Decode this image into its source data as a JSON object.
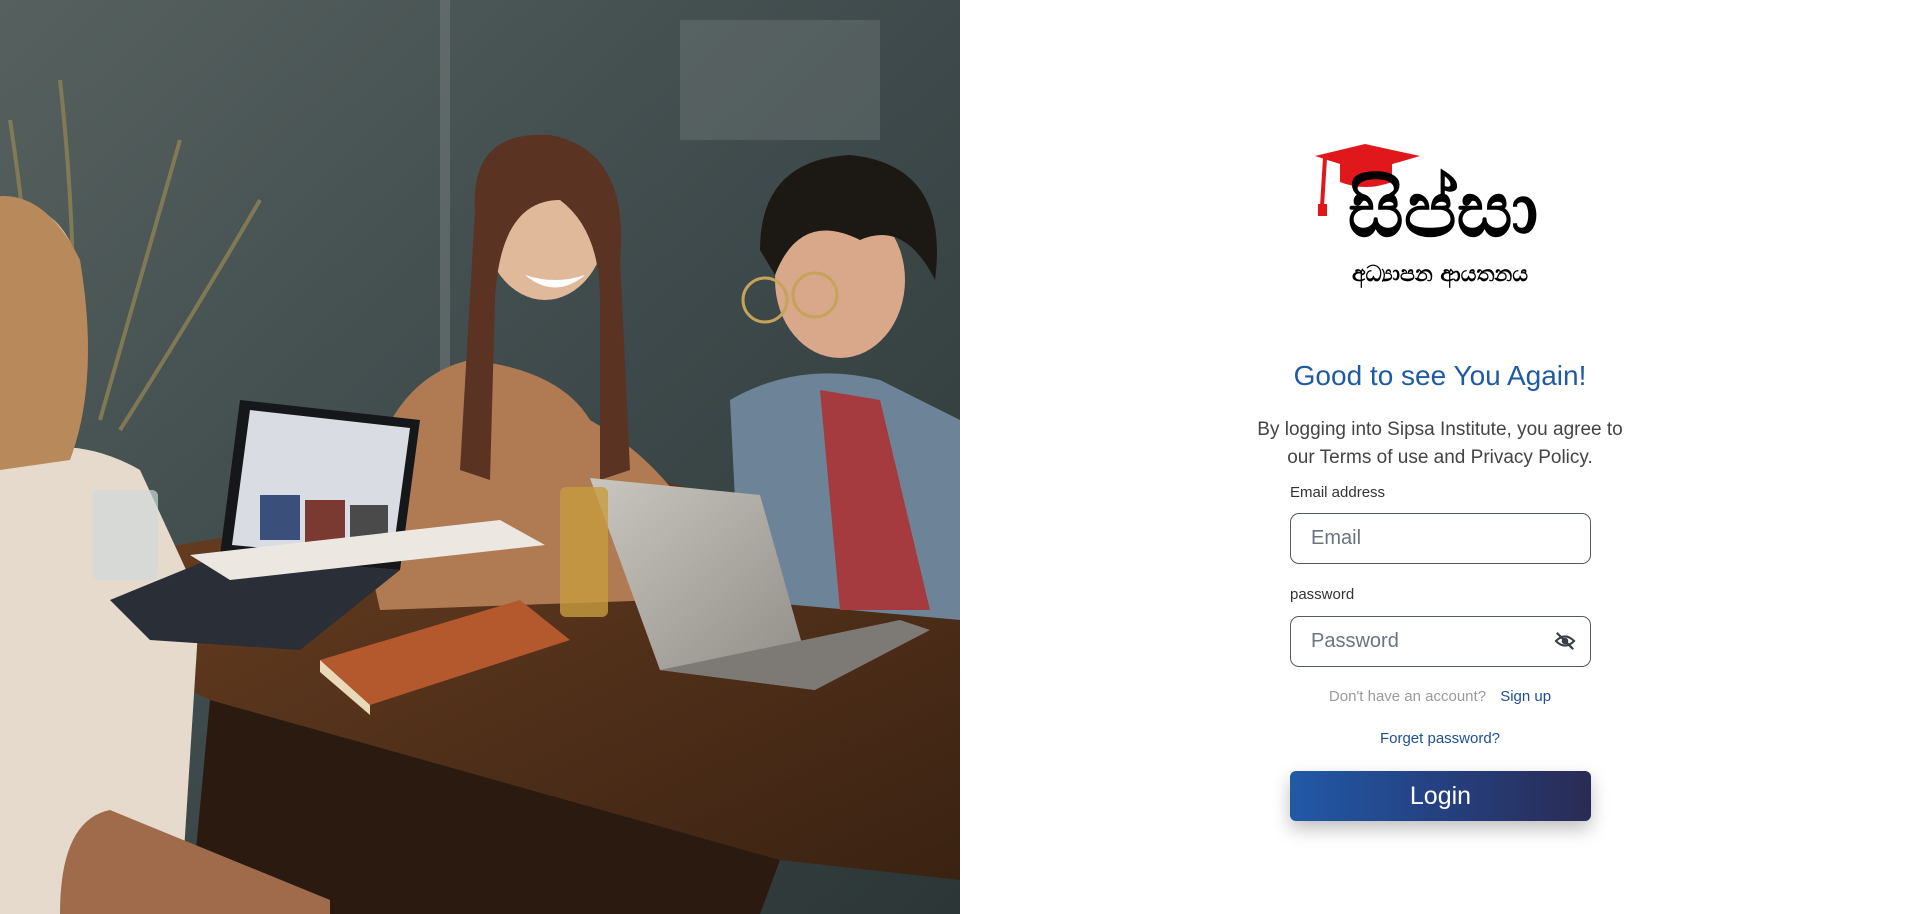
{
  "logo": {
    "title_text": "සිප්සා",
    "subtitle_text": "අධ්‍යාපන ආයතනය",
    "cap_color": "#e0181c",
    "icon": "graduation-cap-icon"
  },
  "login": {
    "heading": "Good to see You Again!",
    "agreement": "By logging into Sipsa Institute, you agree to our Terms of use and Privacy Policy.",
    "email_label": "Email address",
    "email_placeholder": "Email",
    "email_value": "",
    "password_label": "password",
    "password_placeholder": "Password",
    "password_value": "",
    "password_toggle_icon": "eye-off-icon",
    "no_account_text": "Don't have an account?",
    "signup_link": "Sign up",
    "forgot_link": "Forget password?",
    "login_button": "Login"
  },
  "colors": {
    "heading": "#1e5aa5",
    "link": "#1e4f96",
    "button_start": "#2259a8",
    "button_end": "#2a2b54"
  }
}
